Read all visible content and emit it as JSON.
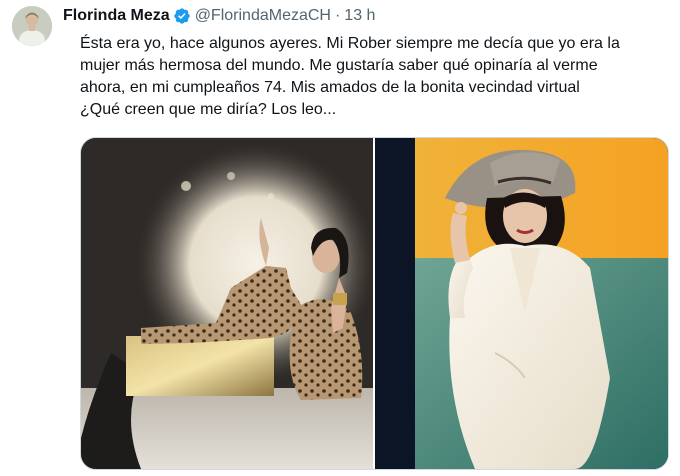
{
  "tweet": {
    "author_name": "Florinda Meza",
    "handle": "@FlorindaMezaCH",
    "separator": "·",
    "time": "13 h",
    "text": "Ésta era yo, hace algunos ayeres. Mi Rober siempre me decía que yo era la\nmujer más hermosa del mundo. Me gustaría saber qué opinaría al verme\nahora, en mi cumpleaños 74. Mis amados de la bonita vecindad virtual\n¿Qué creen que me diría? Los leo..."
  },
  "colors": {
    "verified_badge": "#1d9bf0",
    "secondary_text": "#536471",
    "primary_text": "#0f1419"
  },
  "icons": {
    "verified": "verified-badge-icon"
  }
}
